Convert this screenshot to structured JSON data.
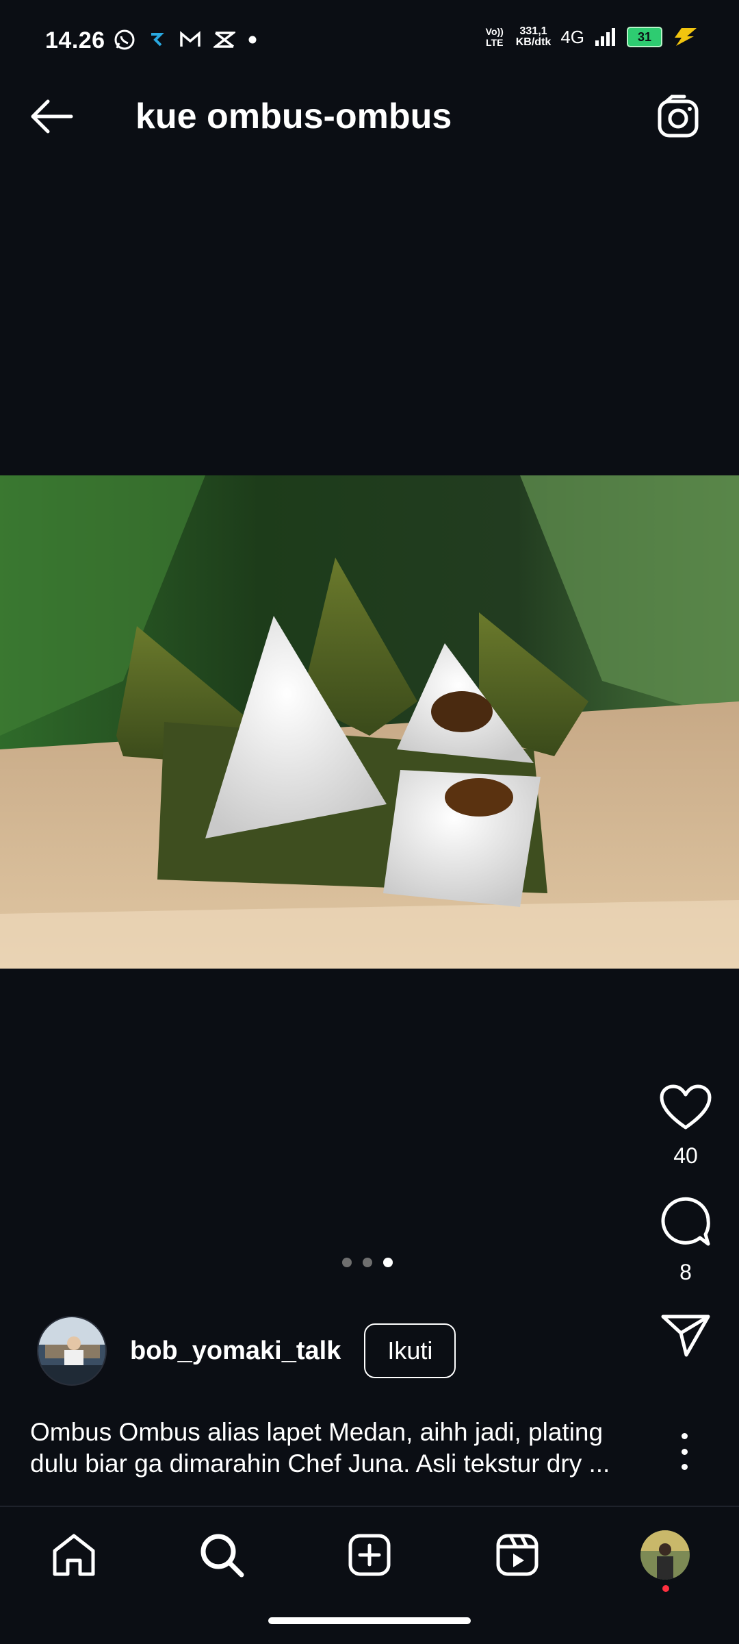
{
  "status_bar": {
    "time": "14.26",
    "app_icons": [
      "whatsapp-icon",
      "app-icon",
      "gmail-icon",
      "capcut-icon",
      "dot-icon"
    ],
    "volte_label": "Vo)) LTE",
    "speed_value": "331,1",
    "speed_unit": "KB/dtk",
    "network": "4G",
    "battery": "31"
  },
  "header": {
    "title": "kue ombus-ombus"
  },
  "post": {
    "carousel_pages": 3,
    "active_page": 3,
    "likes": "40",
    "comments": "8",
    "author": "bob_yomaki_talk",
    "follow_label": "Ikuti",
    "caption_line1": "Ombus Ombus alias lapet Medan, aihh jadi, plating",
    "caption_line2": "dulu biar ga dimarahin Chef Juna. Asli tekstur dry ..."
  },
  "bottom_nav": {
    "items": [
      "home-icon",
      "search-icon",
      "create-icon",
      "reels-icon",
      "profile-avatar"
    ]
  },
  "colors": {
    "background": "#0b0e14",
    "battery": "#2ecc71",
    "notification_badge": "#ff3040",
    "charging": "#f1c40f"
  }
}
